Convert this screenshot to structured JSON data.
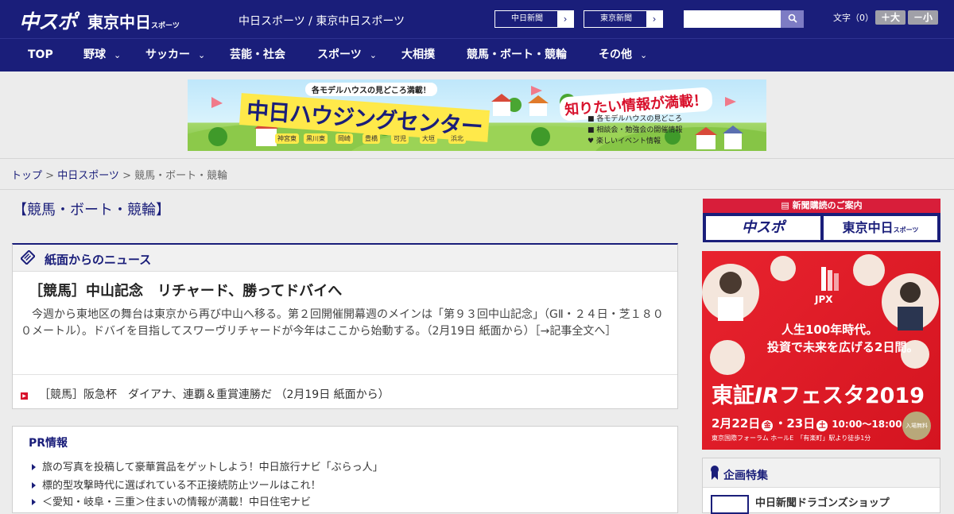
{
  "header": {
    "logo_chuspo": "中スポ",
    "logo_tokyo": "東京中日",
    "logo_tokyo_suffix": "スポーツ",
    "site_name": "中日スポーツ / 東京中日スポーツ",
    "paper_links": [
      {
        "label": "中日新聞",
        "arrow": "›"
      },
      {
        "label": "東京新聞",
        "arrow": "›"
      }
    ],
    "search": {
      "value": "",
      "placeholder": ""
    },
    "font_size_label": "文字（0）",
    "font_bigger": "＋大",
    "font_smaller": "－小"
  },
  "nav": {
    "items": [
      {
        "label": "TOP",
        "dropdown": false
      },
      {
        "label": "野球",
        "dropdown": true
      },
      {
        "label": "サッカー",
        "dropdown": true
      },
      {
        "label": "芸能・社会",
        "dropdown": false
      },
      {
        "label": "スポーツ",
        "dropdown": true
      },
      {
        "label": "大相撲",
        "dropdown": false
      },
      {
        "label": "競馬・ボート・競輪",
        "dropdown": false
      },
      {
        "label": "その他",
        "dropdown": true
      }
    ],
    "chevron": "⌄"
  },
  "banner_ad": {
    "top_text": "各モデルハウスの見どころ満載！",
    "title": "中日ハウジングセンター",
    "slogan": "知りたい情報が満載！",
    "bullets": [
      "各モデルハウスの見どころ",
      "相談会・勉強会の開催情報",
      "楽しいイベント情報"
    ],
    "locations": [
      "神宮東",
      "黒川東",
      "岡崎",
      "豊橋",
      "可児",
      "大垣",
      "浜北"
    ]
  },
  "breadcrumb": {
    "top": "トップ",
    "sep": " > ",
    "section": "中日スポーツ",
    "current": "競馬・ボート・競輪"
  },
  "page_title": "【競馬・ボート・競輪】",
  "news": {
    "heading": "紙面からのニュース",
    "lead_title": "［競馬］中山記念　リチャード、勝ってドバイへ",
    "lead_body": "　今週から東地区の舞台は東京から再び中山へ移る。第２回開催開幕週のメインは「第９３回中山記念」（GⅡ・２４日・芝１８００メートル）。ドバイを目指してスワーヴリチャードが今年はここから始動する。（2月19日 紙面から）［→記事全文へ］",
    "items": [
      {
        "text": "［競馬］阪急杯　ダイアナ、連覇＆重賞連勝だ （2月19日 紙面から）"
      }
    ]
  },
  "pr": {
    "heading": "PR情報",
    "items": [
      "旅の写真を投稿して豪華賞品をゲットしよう！中日旅行ナビ「ぶらっ人」",
      "標的型攻撃時代に選ばれている不正接続防止ツールはこれ！",
      "＜愛知・岐阜・三重＞住まいの情報が満載！中日住宅ナビ"
    ]
  },
  "subscribe": {
    "heading": "新聞購読のご案内",
    "logo_chuspo": "中スポ",
    "logo_tokyo": "東京中日",
    "logo_tokyo_suffix": "スポーツ"
  },
  "jpx_ad": {
    "brand": "JPX",
    "line1": "人生100年時代。",
    "line2": "投資で未来を広げる2日間。",
    "title_prefix": "東証",
    "title_ir": "IR",
    "title_suffix": "フェスタ2019",
    "date1": "2月22日",
    "day1": "金",
    "date2": "23日",
    "day2": "土",
    "time": "10:00～18:00",
    "free": "入場無料",
    "venue": "東京国際フォーラム ホールE",
    "access": "「有楽町」駅より徒歩1分"
  },
  "feature": {
    "heading": "企画特集",
    "first_item": "中日新聞ドラゴンズショップ"
  },
  "colors": {
    "brand_navy": "#1a1e7a",
    "accent_red": "#d8102b"
  }
}
